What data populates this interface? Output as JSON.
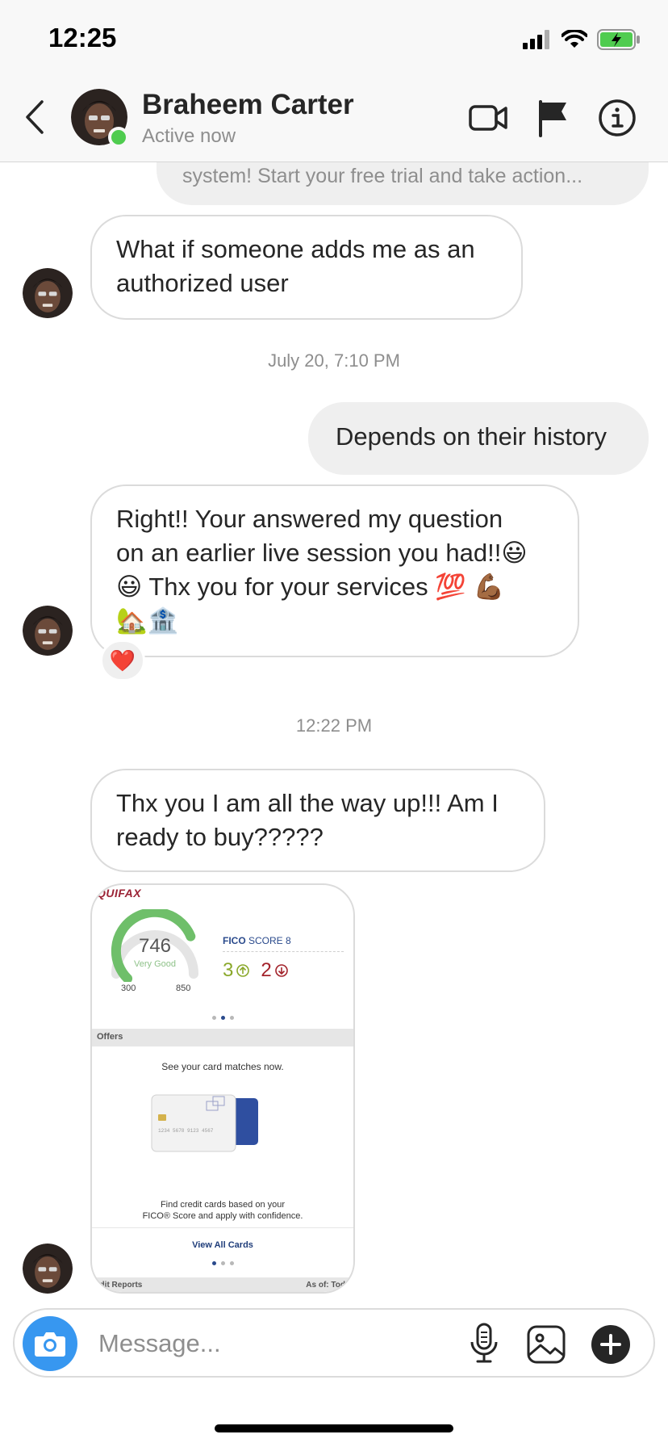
{
  "status_bar": {
    "time": "12:25"
  },
  "header": {
    "contact_name": "Braheem Carter",
    "contact_status": "Active now"
  },
  "thread": {
    "partial_message": "system! Start your free trial and take action...",
    "msg1": "What if someone adds me as an authorized user",
    "timestamp1": "July 20, 7:10 PM",
    "msg2": "Depends on their history",
    "msg3_line1": "Right!! Your answered my question",
    "msg3_line2": "on an earlier live session you had!!😃",
    "msg3_line3": "😃 Thx you for your services 💯 💪🏾",
    "msg3_line4": "🏡🏦",
    "msg3_reaction": "❤️",
    "timestamp2": "12:22 PM",
    "msg4": "Thx you I am all the way up!!! Am I ready to buy?????"
  },
  "shared_image": {
    "brand": "QUIFAX",
    "score": "746",
    "rating": "Very Good",
    "range_min": "300",
    "range_max": "850",
    "score_fraction": 0.75,
    "fico_brand": "FICO",
    "fico_label": "SCORE 8",
    "up_count": "3",
    "down_count": "2",
    "offers_label": "Offers",
    "card_cta": "See your card matches now.",
    "card_number": "1234 5678 9123 4567",
    "find_line1": "Find credit cards based on your",
    "find_line2": "FICO® Score and apply with confidence.",
    "view_all": "View All Cards",
    "footer_left": "edit Reports",
    "footer_right": "As of: Tod"
  },
  "composer": {
    "placeholder": "Message..."
  },
  "colors": {
    "accent": "#3797f0",
    "online": "#4fcc4f",
    "gauge": "#6fbf6a",
    "up": "#8aa82b",
    "down": "#a3232b"
  },
  "icons": [
    "back-chevron-icon",
    "video-camera-icon",
    "flag-icon",
    "info-icon",
    "camera-icon",
    "microphone-icon",
    "gallery-icon",
    "plus-icon"
  ]
}
